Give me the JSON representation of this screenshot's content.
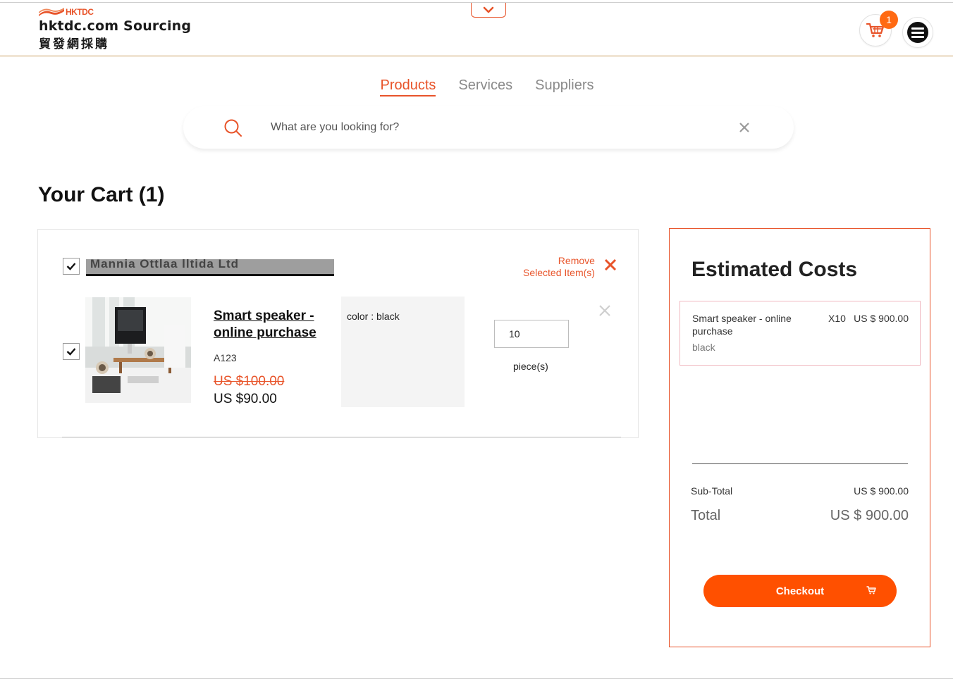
{
  "brand": {
    "logo_small": "HKTDC",
    "name": "hktdc.com Sourcing",
    "name_chinese": "貿發網採購",
    "accent_color": "#e8542a"
  },
  "header": {
    "cart_count": "1",
    "cart_icon": "shopping-cart-icon",
    "menu_icon": "hamburger-menu-icon",
    "dropdown_icon": "chevron-down-icon"
  },
  "tabs": [
    {
      "label": "Products",
      "active": true
    },
    {
      "label": "Services",
      "active": false
    },
    {
      "label": "Suppliers",
      "active": false
    }
  ],
  "search": {
    "placeholder": "What are you looking for?",
    "value": ""
  },
  "page_title": "Your Cart (1)",
  "cart": {
    "supplier_name": "Mannia Ottlaa lltida Ltd",
    "supplier_checked": true,
    "remove_selected_line1": "Remove",
    "remove_selected_line2": "Selected Item(s)",
    "items": [
      {
        "checked": true,
        "name": "Smart speaker - online purchase",
        "code": "A123",
        "price_original": "US $100.00",
        "price_current": "US $90.00",
        "variant": "color : black",
        "quantity": "10",
        "unit": "piece(s)"
      }
    ]
  },
  "estimated": {
    "title": "Estimated Costs",
    "item_name": "Smart speaker - online purchase",
    "item_qty": "X10",
    "item_price": "US $ 900.00",
    "item_variant": "black",
    "subtotal_label": "Sub-Total",
    "subtotal_value": "US $ 900.00",
    "total_label": "Total",
    "total_value": "US $ 900.00",
    "checkout_label": "Checkout",
    "checkout_color": "#ff5000"
  }
}
